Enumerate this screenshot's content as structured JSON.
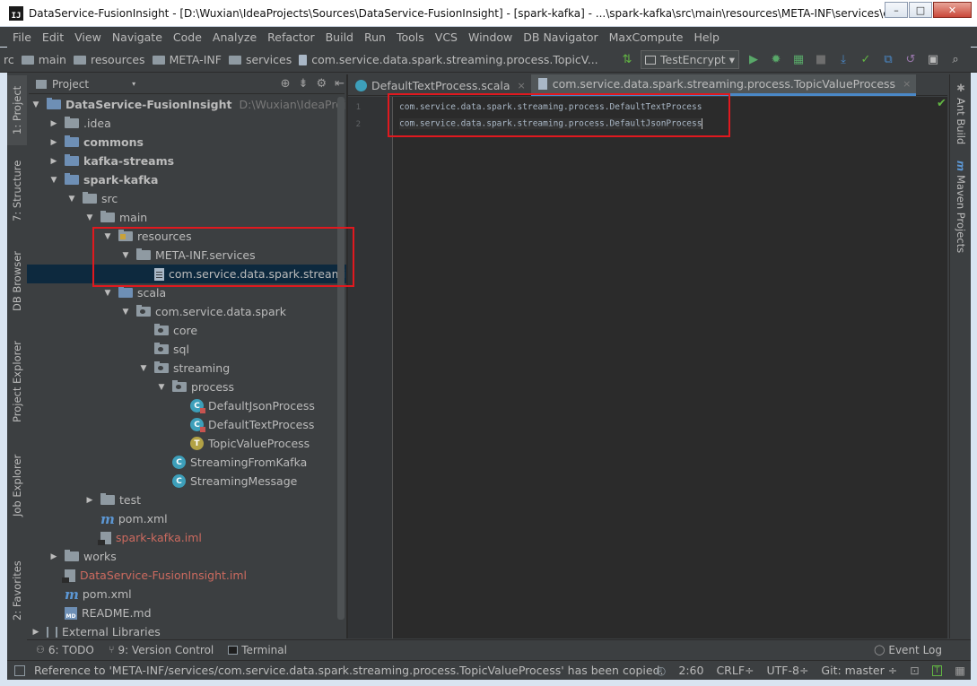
{
  "window": {
    "title": "DataService-FusionInsight - [D:\\Wuxian\\IdeaProjects\\Sources\\DataService-FusionInsight] - [spark-kafka] - ...\\spark-kafka\\src\\main\\resources\\META-INF\\services\\c...",
    "app_icon": "IJ",
    "minimize": "–",
    "maximize": "□",
    "close": "✕"
  },
  "menu": [
    "File",
    "Edit",
    "View",
    "Navigate",
    "Code",
    "Analyze",
    "Refactor",
    "Build",
    "Run",
    "Tools",
    "VCS",
    "Window",
    "DB Navigator",
    "MaxCompute",
    "Help"
  ],
  "breadcrumbs": [
    "rc",
    "main",
    "resources",
    "META-INF",
    "services",
    "com.service.data.spark.streaming.process.TopicV..."
  ],
  "run_config": {
    "label": "TestEncrypt",
    "caret": "▾"
  },
  "left_tabs": [
    "1: Project",
    "7: Structure",
    "DB Browser",
    "Project Explorer",
    "Job Explorer",
    "2: Favorites"
  ],
  "right_tabs": [
    "Ant Build",
    "Maven Projects"
  ],
  "project_panel": {
    "title": "Project",
    "dropdown": "▾"
  },
  "tree": [
    {
      "label": "DataService-FusionInsight",
      "hint": "D:\\Wuxian\\IdeaProjects\\S",
      "icon": "folder-blue",
      "arrow": "▼",
      "bold": true
    },
    {
      "label": ".idea",
      "icon": "folder",
      "arrow": "▶"
    },
    {
      "label": "commons",
      "icon": "folder-blue",
      "arrow": "▶",
      "bold": true
    },
    {
      "label": "kafka-streams",
      "icon": "folder-blue",
      "arrow": "▶",
      "bold": true
    },
    {
      "label": "spark-kafka",
      "icon": "folder-blue",
      "arrow": "▼",
      "bold": true
    },
    {
      "label": "src",
      "icon": "folder",
      "arrow": "▼"
    },
    {
      "label": "main",
      "icon": "folder",
      "arrow": "▼"
    },
    {
      "label": "resources",
      "icon": "folder-res",
      "arrow": "▼"
    },
    {
      "label": "META-INF.services",
      "icon": "folder",
      "arrow": "▼"
    },
    {
      "label": "com.service.data.spark.streaming",
      "icon": "file",
      "arrow": "",
      "selected": true
    },
    {
      "label": "scala",
      "icon": "folder-blue",
      "arrow": "▼"
    },
    {
      "label": "com.service.data.spark",
      "icon": "folder-pkg",
      "arrow": "▼"
    },
    {
      "label": "core",
      "icon": "folder-pkg",
      "arrow": ""
    },
    {
      "label": "sql",
      "icon": "folder-pkg",
      "arrow": ""
    },
    {
      "label": "streaming",
      "icon": "folder-pkg",
      "arrow": "▼"
    },
    {
      "label": "process",
      "icon": "folder-pkg",
      "arrow": "▼"
    },
    {
      "label": "DefaultJsonProcess",
      "icon": "class-sub",
      "arrow": ""
    },
    {
      "label": "DefaultTextProcess",
      "icon": "class-sub",
      "arrow": ""
    },
    {
      "label": "TopicValueProcess",
      "icon": "trait",
      "arrow": ""
    },
    {
      "label": "StreamingFromKafka",
      "icon": "class",
      "arrow": ""
    },
    {
      "label": "StreamingMessage",
      "icon": "class",
      "arrow": ""
    },
    {
      "label": "test",
      "icon": "folder",
      "arrow": "▶"
    },
    {
      "label": "pom.xml",
      "icon": "maven",
      "arrow": ""
    },
    {
      "label": "spark-kafka.iml",
      "icon": "iml",
      "arrow": "",
      "red": true
    },
    {
      "label": "works",
      "icon": "folder",
      "arrow": "▶"
    },
    {
      "label": "DataService-FusionInsight.iml",
      "icon": "iml",
      "arrow": "",
      "red": true
    },
    {
      "label": "pom.xml",
      "icon": "maven",
      "arrow": ""
    },
    {
      "label": "README.md",
      "icon": "md",
      "arrow": ""
    },
    {
      "label": "External Libraries",
      "icon": "lib",
      "arrow": "▶"
    }
  ],
  "editor": {
    "tabs": [
      {
        "label": "DefaultTextProcess.scala",
        "close": "×",
        "icon": "scala-class"
      },
      {
        "label": "com.service.data.spark.streaming.process.TopicValueProcess",
        "close": "×",
        "icon": "text-file",
        "active": true
      }
    ],
    "line_numbers": [
      "1",
      "2"
    ],
    "lines": [
      "com.service.data.spark.streaming.process.DefaultTextProcess",
      "com.service.data.spark.streaming.process.DefaultJsonProcess"
    ],
    "check": "✔"
  },
  "bottom_tabs": [
    {
      "label": "6: TODO",
      "icon": "todo-icon"
    },
    {
      "label": "9: Version Control",
      "icon": "vcs-icon"
    },
    {
      "label": "Terminal",
      "icon": "terminal-icon"
    }
  ],
  "event_log": "Event Log",
  "status": {
    "message": "Reference to 'META-INF/services/com.service.data.spark.streaming.process.TopicValueProcess' has been copied.",
    "position": "2:60",
    "line_sep": "CRLF÷",
    "encoding": "UTF-8÷",
    "git": "Git: master ÷"
  },
  "colors": {
    "highlight_box": "#e0191f",
    "selection": "#0d293e",
    "active_tab_underline": "#4a88c7"
  }
}
